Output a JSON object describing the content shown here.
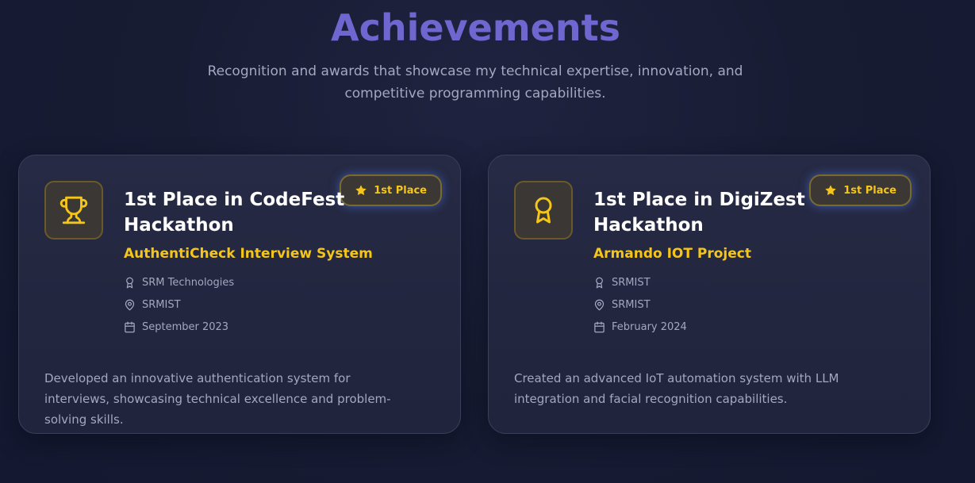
{
  "section": {
    "title": "Achievements",
    "subtitle": "Recognition and awards that showcase my technical expertise, innovation, and competitive programming capabilities."
  },
  "colors": {
    "title": "#6f66d0",
    "accent": "#f5c518",
    "text_muted": "#a3a8c0",
    "card_bg": "#252941",
    "badge_glow": "#4f7dff"
  },
  "achievements": [
    {
      "icon": "trophy-icon",
      "badge": "1st Place",
      "title": "1st Place in CodeFest Hackathon",
      "project": "AuthentiCheck Interview System",
      "organizer": "SRM Technologies",
      "location": "SRMIST",
      "date": "September 2023",
      "description": "Developed an innovative authentication system for interviews, showcasing technical excellence and problem-solving skills."
    },
    {
      "icon": "award-ribbon-icon",
      "badge": "1st Place",
      "title": "1st Place in DigiZest Hackathon",
      "project": "Armando IOT Project",
      "organizer": "SRMIST",
      "location": "SRMIST",
      "date": "February 2024",
      "description": "Created an advanced IoT automation system with LLM integration and facial recognition capabilities."
    }
  ]
}
